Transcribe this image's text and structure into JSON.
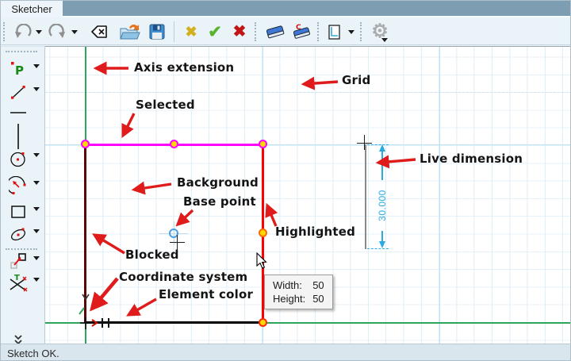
{
  "tab_bar": {
    "active_tab": "Sketcher"
  },
  "toolbar": {
    "icons": [
      "undo",
      "undo-options",
      "redo",
      "redo-options",
      "delete-backspace",
      "open-sketch",
      "save-sketch",
      "cancel",
      "accept",
      "delete",
      "erase",
      "erase-color",
      "sheet-view-options",
      "settings-gear-disabled"
    ]
  },
  "toolbox": {
    "icons": [
      "point",
      "line",
      "horizontal-line",
      "vertical-line",
      "circle",
      "arc",
      "rectangle",
      "ellipse",
      "copy-move",
      "trim",
      "more-tools-chevron"
    ]
  },
  "annotations": [
    {
      "label": "Axis extension"
    },
    {
      "label": "Grid"
    },
    {
      "label": "Selected"
    },
    {
      "label": "Background"
    },
    {
      "label": "Base point"
    },
    {
      "label": "Highlighted"
    },
    {
      "label": "Live dimension"
    },
    {
      "label": "Blocked"
    },
    {
      "label": "Coordinate system"
    },
    {
      "label": "Element color"
    }
  ],
  "dimension": {
    "value": "30.000"
  },
  "tooltip": {
    "width_label": "Width:",
    "width_value": "50",
    "height_label": "Height:",
    "height_value": "50"
  },
  "status_bar": {
    "text": "Sketch OK."
  },
  "colors": {
    "selected": "#ff00ff",
    "highlighted": "#ff0000",
    "blocked": "#5a0505",
    "element_color": "#000000",
    "axis": "#2fa45b",
    "dimension": "#29abe2",
    "annotation_arrow": "#e01b1b",
    "vertex_fill": "#ffd800",
    "grid_minor": "#ddeef8",
    "grid_major": "#bfe3f3"
  }
}
